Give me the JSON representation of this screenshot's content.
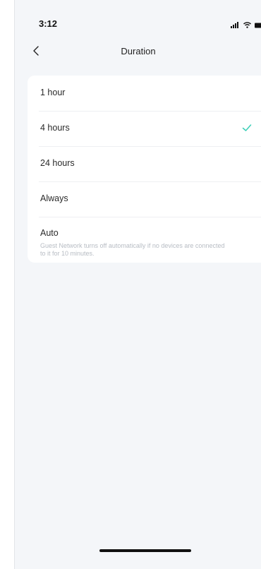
{
  "status_bar": {
    "time": "3:12",
    "icons": [
      "cellular-signal-icon",
      "wifi-icon",
      "battery-icon"
    ]
  },
  "nav": {
    "title": "Duration",
    "back_icon": "chevron-left-icon"
  },
  "options": [
    {
      "label": "1 hour",
      "selected": false
    },
    {
      "label": "4 hours",
      "selected": true
    },
    {
      "label": "24 hours",
      "selected": false
    },
    {
      "label": "Always",
      "selected": false
    },
    {
      "label": "Auto",
      "selected": false,
      "description": "Guest Network turns off automatically if no devices are connected to it for 10 minutes."
    }
  ],
  "colors": {
    "accent": "#3ccfb7",
    "background": "#f4f6f9",
    "card": "#ffffff",
    "description_text": "#b7bcc3"
  }
}
